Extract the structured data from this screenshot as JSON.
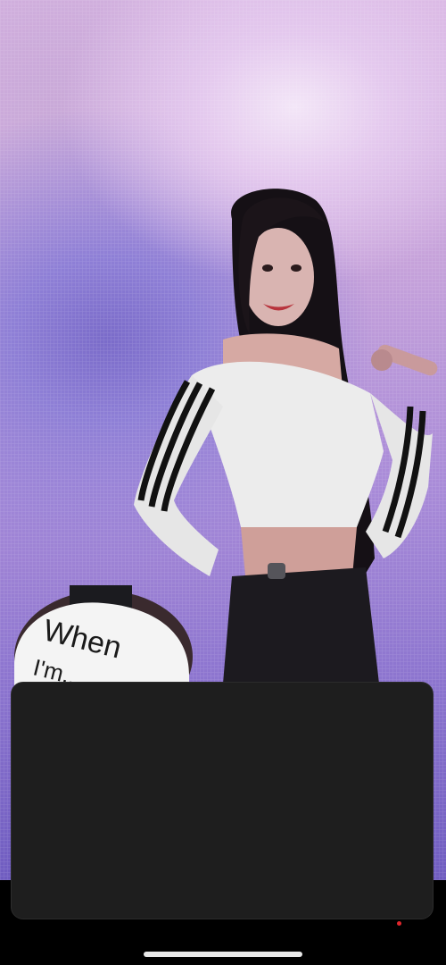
{
  "video": {
    "sign_text_line1": "When",
    "sign_text_line2": "I'm..."
  },
  "overlay": {
    "sheet_state": "empty"
  },
  "colors": {
    "sheet": "#1e1e1e",
    "home_indicator": "#e9e9e9",
    "recording_dot": "#e0262c"
  }
}
